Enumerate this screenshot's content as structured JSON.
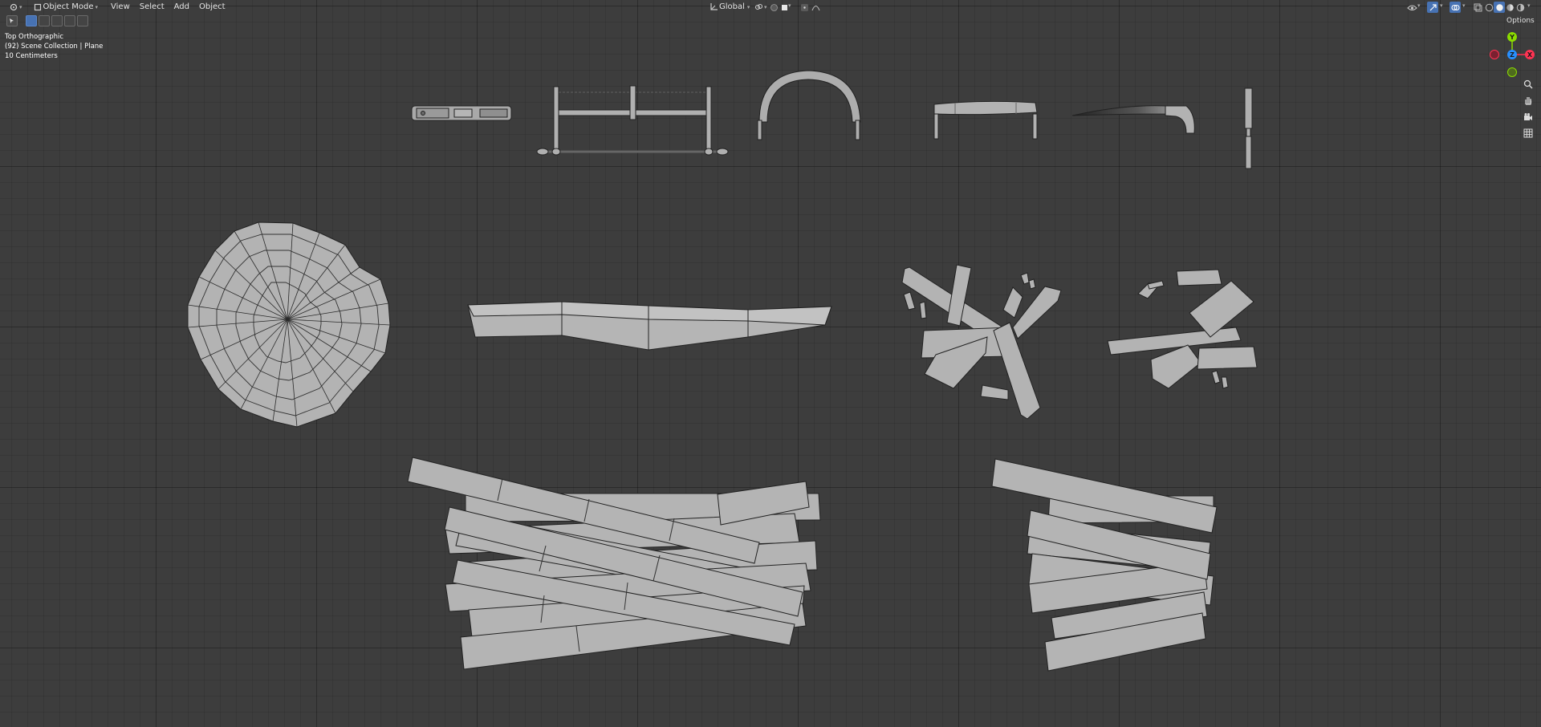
{
  "header": {
    "mode_label": "Object Mode",
    "menu": [
      "View",
      "Select",
      "Add",
      "Object"
    ],
    "orientation_label": "Global",
    "options_label": "Options"
  },
  "overlay_info": {
    "view_name": "Top Orthographic",
    "collection": "(92) Scene Collection | Plane",
    "scale": "10 Centimeters"
  },
  "gizmo": {
    "y_label": "Y",
    "z_label": "Z",
    "x_label": "X",
    "colors": {
      "x": "#ff3352",
      "y": "#8bdc00",
      "z": "#2890ff"
    }
  },
  "nav_icons": [
    "zoom-icon",
    "hand-pan-icon",
    "camera-icon",
    "grid-toggle-icon"
  ],
  "objects": [
    "hand-plane",
    "bow-saw",
    "arch-handle",
    "drawknife",
    "pruning-knife",
    "chisel",
    "log-cross-section",
    "wood-plank",
    "broken-sticks-1",
    "broken-sticks-2",
    "plank-pile-large",
    "plank-pile-small"
  ]
}
